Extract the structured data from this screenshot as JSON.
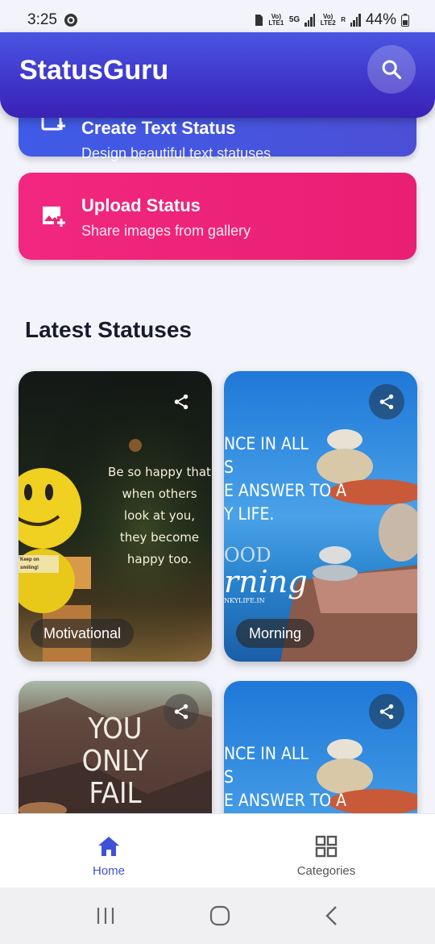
{
  "status_bar": {
    "time": "3:25",
    "sim1_label": "Vo) LTE1",
    "network": "5G",
    "sim2_label": "Vo) LTE2",
    "roaming": "R",
    "battery": "44%"
  },
  "app_bar": {
    "title": "StatusGuru",
    "search_icon": "search-icon"
  },
  "actions": [
    {
      "title": "Create Text Status",
      "subtitle": "Design beautiful text statuses",
      "icon": "text-add-icon",
      "color": "#4358e4"
    },
    {
      "title": "Upload Status",
      "subtitle": "Share images from gallery",
      "icon": "image-add-icon",
      "color": "#f0247c"
    }
  ],
  "section": {
    "title": "Latest Statuses"
  },
  "statuses": [
    {
      "category": "Motivational",
      "quote_lines": [
        "Be so happy that",
        "when others",
        "look at you,",
        "they become",
        "happy too."
      ],
      "emoji_sign": "Keep on smiling!"
    },
    {
      "category": "Morning",
      "quote_lines": [
        "NCE IN ALL",
        "S",
        "E ANSWER TO A",
        "Y LIFE."
      ],
      "brand_lines": [
        "OOD",
        "rning",
        "NKYLIFE.IN"
      ]
    },
    {
      "category": "",
      "quote_lines": [
        "YOU",
        "ONLY",
        "FAIL"
      ]
    },
    {
      "category": "",
      "quote_lines": [
        "NCE IN ALL",
        "S",
        "E ANSWER TO A"
      ]
    }
  ],
  "bottom_nav": {
    "items": [
      {
        "label": "Home",
        "icon": "home-icon",
        "active": true
      },
      {
        "label": "Categories",
        "icon": "grid-icon",
        "active": false
      }
    ]
  },
  "colors": {
    "accent": "#3f51d8",
    "app_bar_start": "#4a55e3",
    "app_bar_end": "#3a22b5",
    "upload_card": "#f0247c"
  }
}
